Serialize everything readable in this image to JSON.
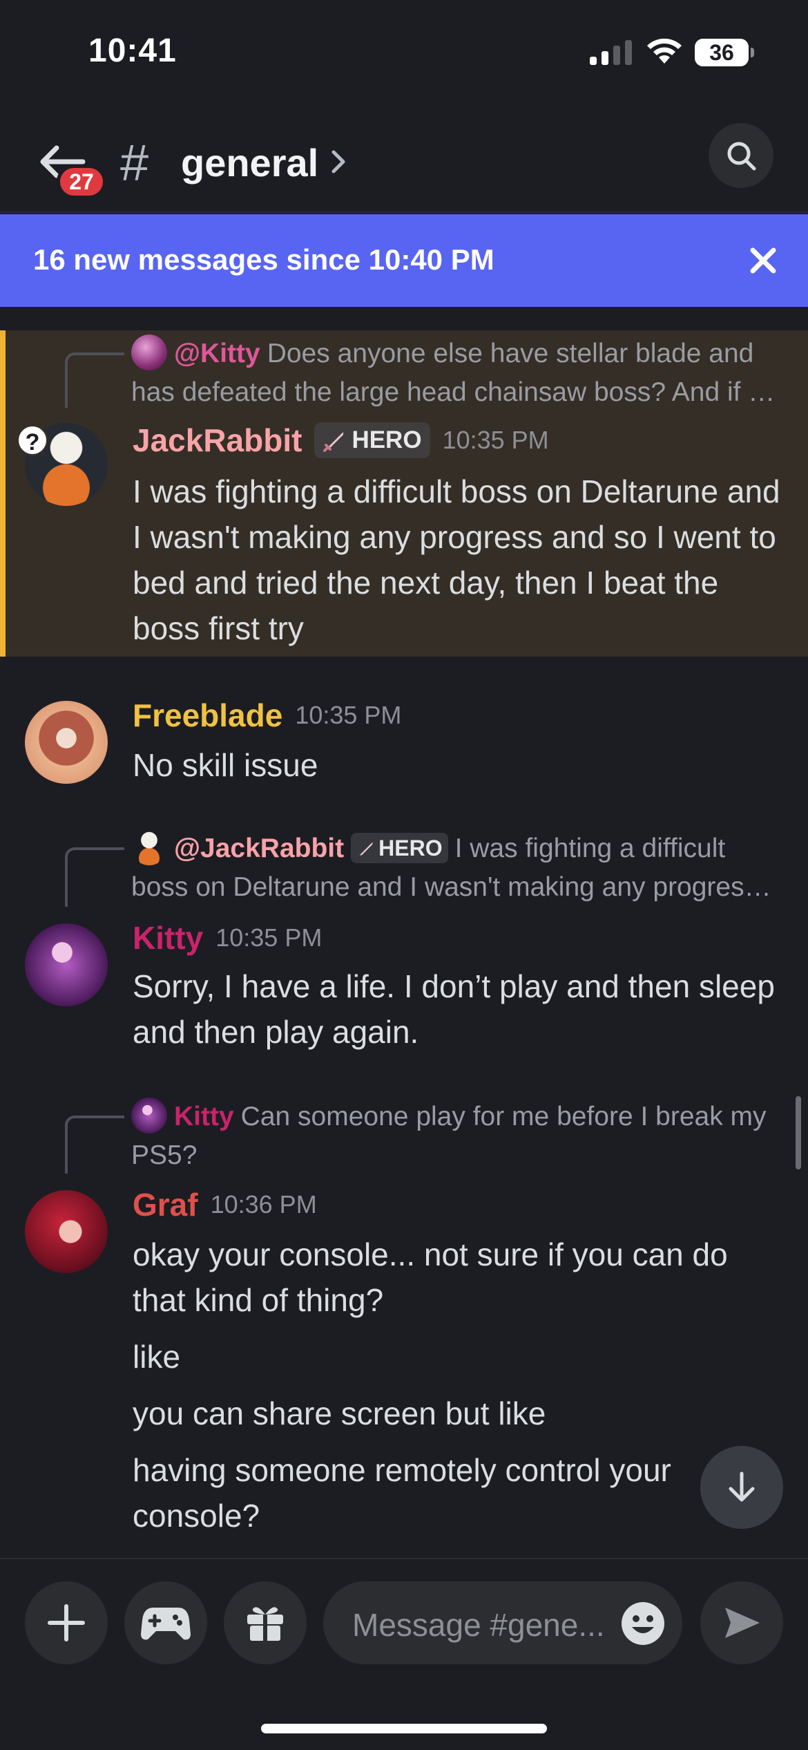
{
  "status": {
    "time": "10:41",
    "battery": "36"
  },
  "header": {
    "unread_count": "27",
    "hash": "#",
    "channel": "general"
  },
  "new_messages": {
    "text": "16 new messages since 10:40 PM"
  },
  "messages": [
    {
      "reply": {
        "mention": "@Kitty",
        "text": "Does anyone else have stellar blade and has defeated the large head chainsaw boss? And if …",
        "mention_color": "#e0579a"
      },
      "author": "JackRabbit",
      "author_color": "#f8a3a8",
      "badge": "HERO",
      "time": "10:35 PM",
      "lines": [
        "I was fighting a difficult boss on Deltarune and I wasn't making any progress and so I went to bed and tried the next day, then I beat the boss first try"
      ],
      "status_badge": "?"
    },
    {
      "author": "Freeblade",
      "author_color": "#f0c242",
      "time": "10:35 PM",
      "lines": [
        "No skill issue"
      ]
    },
    {
      "reply": {
        "mention": "@JackRabbit",
        "badge": "HERO",
        "text": "I was fighting a difficult boss on Deltarune and I wasn't making any progres…",
        "mention_color": "#f8a3a8"
      },
      "author": "Kitty",
      "author_color": "#c9236b",
      "time": "10:35 PM",
      "lines": [
        "Sorry, I have a life. I don’t play and then sleep and then play again."
      ]
    },
    {
      "reply": {
        "mention": "Kitty",
        "text": "Can someone play for me before I break my PS5?",
        "mention_color": "#c9236b"
      },
      "author": "Graf",
      "author_color": "#e0504a",
      "time": "10:36 PM",
      "lines": [
        "okay your console... not sure if you can do that kind of thing?",
        "like",
        "you can share screen but like",
        "having someone remotely control your console?"
      ]
    }
  ],
  "composer": {
    "placeholder": "Message #gene..."
  }
}
